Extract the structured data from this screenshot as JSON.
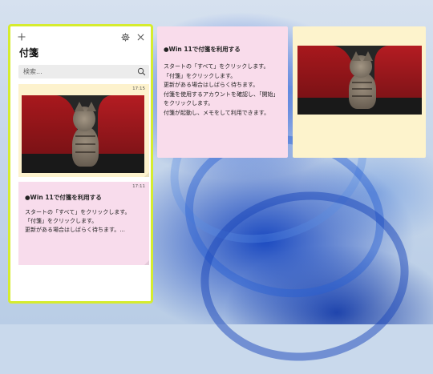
{
  "list_window": {
    "title": "付箋",
    "search_placeholder": "検索...",
    "icons": {
      "add": "plus-icon",
      "settings": "gear-icon",
      "close": "close-icon",
      "search": "search-icon"
    },
    "notes": [
      {
        "time": "17:15",
        "type": "image"
      },
      {
        "time": "17:11",
        "title": "●Win 11で付箋を利用する",
        "body": "スタートの「すべて」をクリックします。\n「付箋」をクリックします。\n更新がある場合はしばらく待ちます。..."
      }
    ]
  },
  "pink_note": {
    "title": "●Win 11で付箋を利用する",
    "body": "スタートの「すべて」をクリックします。\n「付箋」をクリックします。\n更新がある場合はしばらく待ちます。\n付箋を使用するアカウントを確認し、「開始」をクリックします。\n付箋が起動し、メモをして利用できます。"
  },
  "colors": {
    "highlight_border": "#d6ec2e",
    "yellow_note": "#fdf3cc",
    "pink_note": "#f9dceb"
  }
}
